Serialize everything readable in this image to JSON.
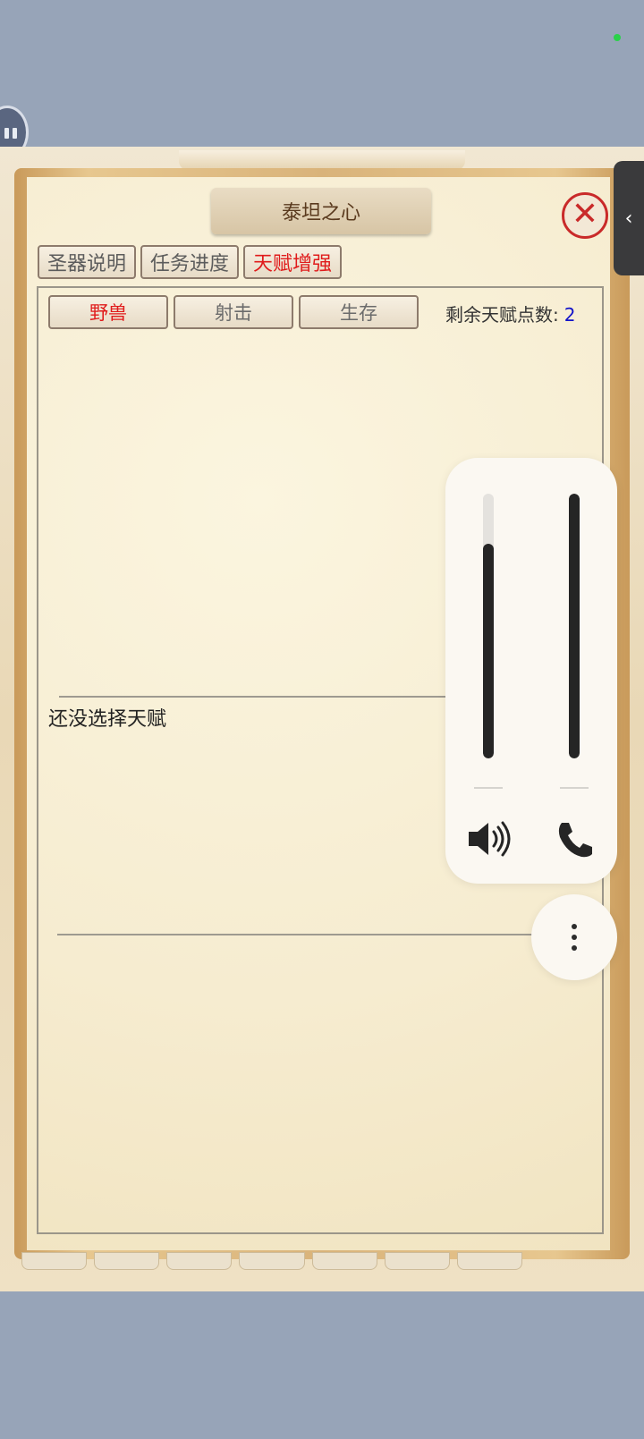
{
  "window": {
    "title": "泰坦之心"
  },
  "tabs": [
    {
      "label": "圣器说明",
      "active": false
    },
    {
      "label": "任务进度",
      "active": false
    },
    {
      "label": "天赋增强",
      "active": true
    }
  ],
  "subtabs": [
    {
      "label": "野兽",
      "active": true
    },
    {
      "label": "射击",
      "active": false
    },
    {
      "label": "生存",
      "active": false
    }
  ],
  "talent": {
    "remaining_label": "剩余天赋点数:",
    "remaining_value": "2",
    "empty_message": "还没选择天赋"
  },
  "volume_overlay": {
    "media_level": 0.81,
    "call_level": 1.0,
    "media_icon": "speaker-icon",
    "call_icon": "phone-icon",
    "more_icon": "more-vertical-icon"
  },
  "colors": {
    "active_tab": "#e01b1b",
    "points_value": "#1313c9",
    "title_text": "#5a3a1e"
  }
}
